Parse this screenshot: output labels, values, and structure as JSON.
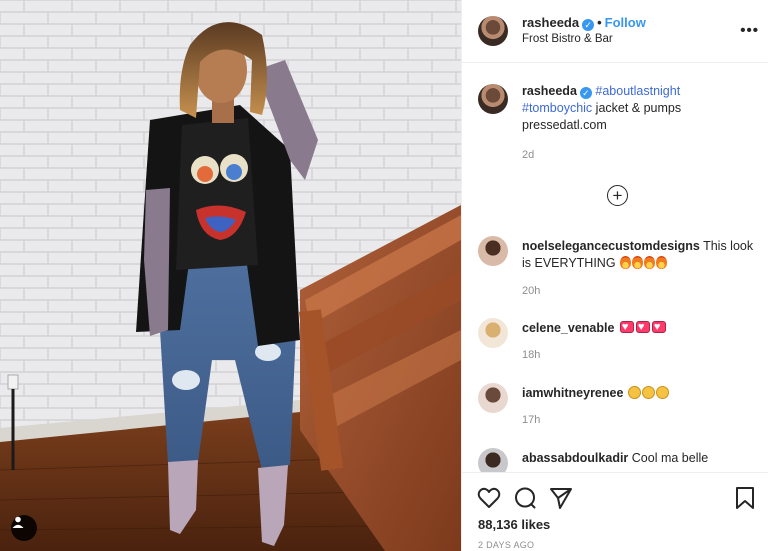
{
  "post": {
    "username": "rasheeda",
    "follow_label": "Follow",
    "location": "Frost Bistro & Bar",
    "more_label": "•••"
  },
  "caption": {
    "username": "rasheeda",
    "hashtag1": "#aboutlastnight",
    "hashtag2": "#tomboychic",
    "text": "jacket & pumps",
    "link": "pressedatl.com",
    "time": "2d"
  },
  "comments": [
    {
      "username": "noelselegancecustomdesigns",
      "text": "This look is EVERYTHING",
      "time": "20h",
      "emoji": "fire-emoji x4"
    },
    {
      "username": "celene_venable",
      "text": "",
      "time": "18h",
      "emoji": "heart-emoji x3"
    },
    {
      "username": "iamwhitneyrenee",
      "text": "",
      "time": "17h",
      "emoji": "clap-emoji x3"
    },
    {
      "username": "abassabdoulkadir",
      "text": "Cool ma belle",
      "time": ""
    }
  ],
  "stats": {
    "likes": "88,136 likes",
    "date": "2 DAYS AGO"
  },
  "icons": [
    "heart-icon",
    "comment-icon",
    "share-icon",
    "bookmark-icon",
    "plus-circle-icon",
    "user-tag-icon",
    "verified-icon"
  ],
  "colors": {
    "link_blue": "#3897f0",
    "hashtag": "#00376b",
    "meta_gray": "#8e8e8e",
    "border": "#efefef"
  }
}
